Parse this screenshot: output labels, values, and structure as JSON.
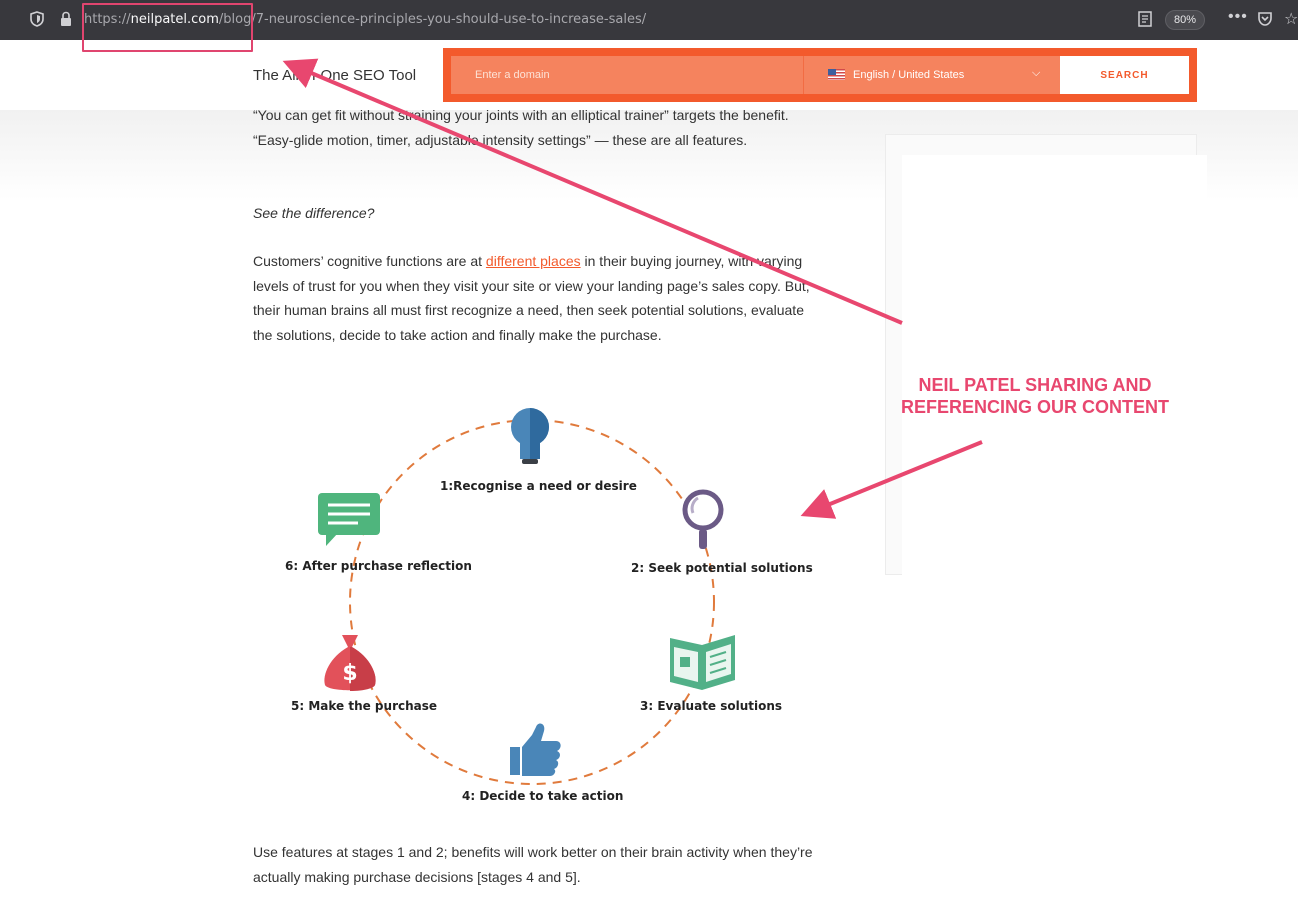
{
  "browser": {
    "url_prefix": "https://",
    "url_domain": "neilpatel.com",
    "url_path": "/blog/7-neuroscience-principles-you-should-use-to-increase-sales/",
    "zoom": "80%",
    "more_label": "•••"
  },
  "header": {
    "tagline": "The All-in-One SEO Tool",
    "domain_placeholder": "Enter a domain",
    "language": "English / United States",
    "search_label": "SEARCH"
  },
  "article": {
    "p1": "“You can get fit without straining your joints with an elliptical trainer” targets the benefit. “Easy-glide motion, timer, adjustable intensity settings” — these are all features.",
    "p2": "See the difference?",
    "p3_before": "Customers’ cognitive functions are at ",
    "p3_link": "different places",
    "p3_after": " in their buying journey, with varying levels of trust for you when they visit your site or view your landing page’s sales copy. But, their human brains all must first recognize a need, then seek potential solutions, evaluate the solutions, decide to take action and finally make the purchase.",
    "p4": "Use features at stages 1 and 2; benefits will work better on their brain activity when they’re actually making purchase decisions [stages 4 and 5]."
  },
  "diagram": {
    "steps": [
      "1:Recognise a need or desire",
      "2: Seek potential solutions",
      "3: Evaluate solutions",
      "4: Decide to take action",
      "5: Make the purchase",
      "6: After purchase reflection"
    ],
    "colors": {
      "circle": "#e07a3c",
      "bulb": "#4a86b8",
      "magnifier": "#6b5a86",
      "paper": "#52b088",
      "thumb": "#4a86b8",
      "bag": "#e2515a",
      "chat": "#4fb57d"
    }
  },
  "annotation": {
    "line1": "NEIL PATEL SHARING AND",
    "line2": "REFERENCING OUR CONTENT",
    "color": "#e8476f"
  }
}
